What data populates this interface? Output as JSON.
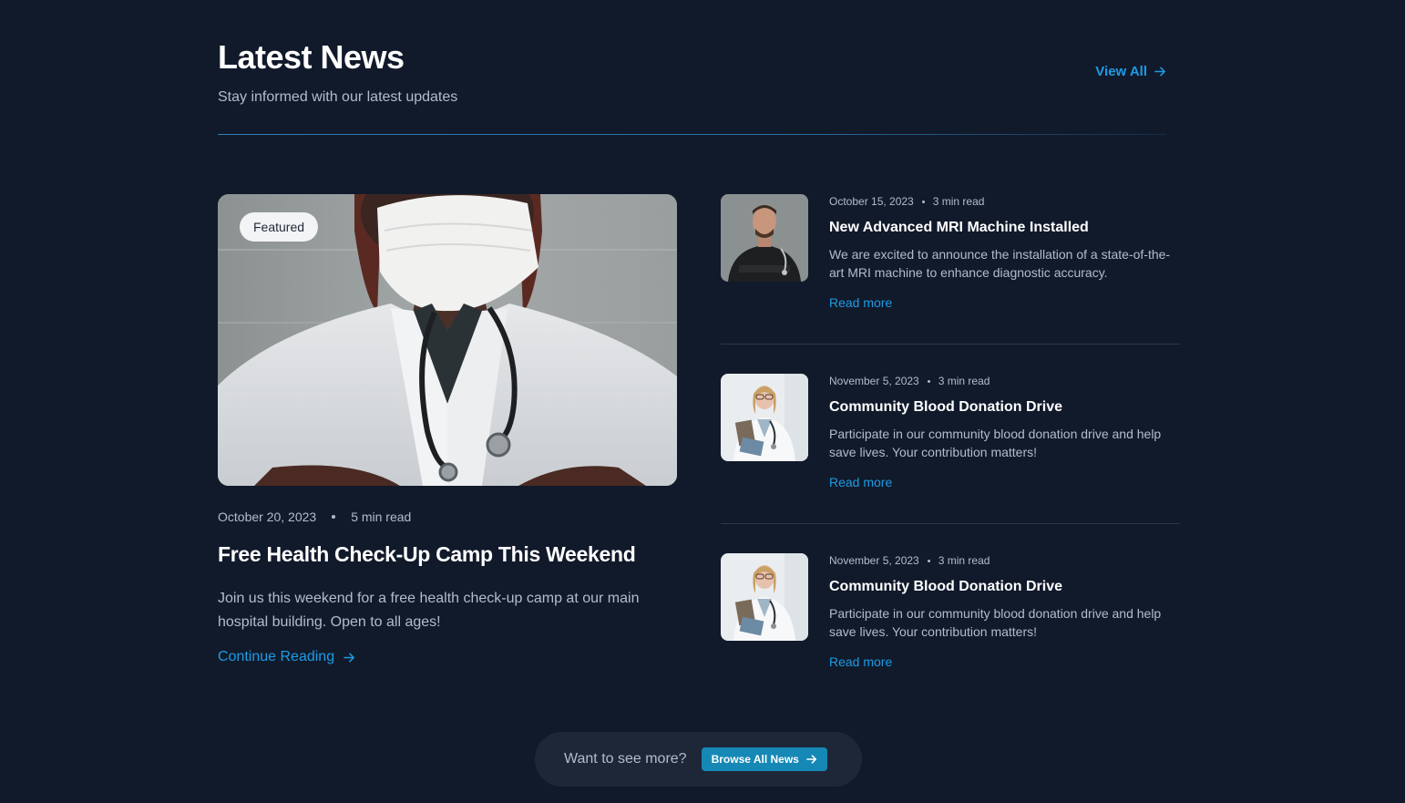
{
  "header": {
    "title": "Latest News",
    "subtitle": "Stay informed with our latest updates",
    "view_all_label": "View All"
  },
  "featured": {
    "badge": "Featured",
    "date": "October 20, 2023",
    "read_time": "5 min read",
    "title": "Free Health Check-Up Camp This Weekend",
    "description": "Join us this weekend for a free health check-up camp at our main hospital building. Open to all ages!",
    "link_label": "Continue Reading"
  },
  "news": [
    {
      "date": "October 15, 2023",
      "read_time": "3 min read",
      "title": "New Advanced MRI Machine Installed",
      "description": "We are excited to announce the installation of a state-of-the-art MRI machine to enhance diagnostic accuracy.",
      "link_label": "Read more"
    },
    {
      "date": "November 5, 2023",
      "read_time": "3 min read",
      "title": "Community Blood Donation Drive",
      "description": "Participate in our community blood donation drive and help save lives. Your contribution matters!",
      "link_label": "Read more"
    },
    {
      "date": "November 5, 2023",
      "read_time": "3 min read",
      "title": "Community Blood Donation Drive",
      "description": "Participate in our community blood donation drive and help save lives. Your contribution matters!",
      "link_label": "Read more"
    }
  ],
  "cta": {
    "text": "Want to see more?",
    "button_label": "Browse All News"
  },
  "colors": {
    "background": "#111a2b",
    "accent": "#1e9be3",
    "button": "#1688b5"
  }
}
